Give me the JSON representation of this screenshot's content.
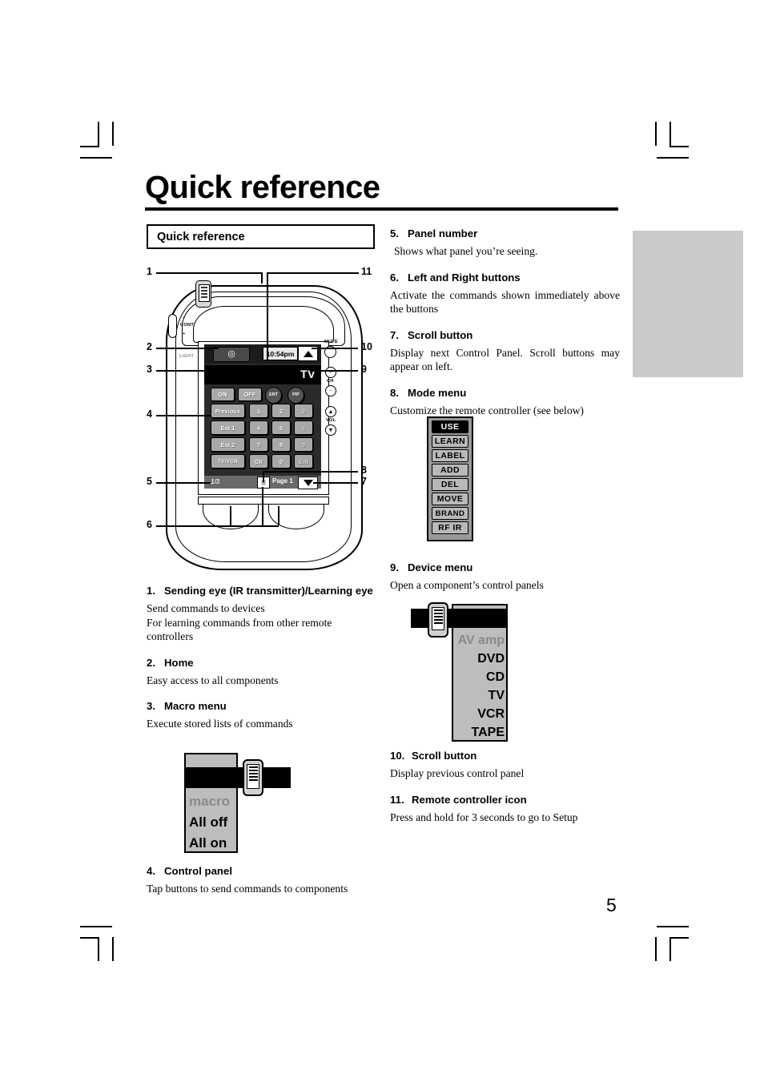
{
  "page": {
    "title": "Quick reference",
    "number": "5",
    "section_box_label": "Quick reference"
  },
  "items_left": [
    {
      "num": "1.",
      "title": "Sending eye (IR transmitter)/Learning eye",
      "body_line1": "Send commands to devices",
      "body_line2": "For learning commands from other remote controllers"
    },
    {
      "num": "2.",
      "title": "Home",
      "body_line1": "Easy access to all components"
    },
    {
      "num": "3.",
      "title": "Macro menu",
      "body_line1": "Execute stored lists of commands"
    },
    {
      "num": "4.",
      "title": "Control panel",
      "body_line1": "Tap buttons to send commands to components"
    }
  ],
  "items_right": [
    {
      "num": "5.",
      "title": "Panel number",
      "body_line1": "Shows what panel you’re seeing."
    },
    {
      "num": "6.",
      "title": "Left and Right buttons",
      "body_line1": "Activate the commands shown immediately above the buttons"
    },
    {
      "num": "7.",
      "title": "Scroll button",
      "body_line1": "Display next Control Panel. Scroll buttons may appear on left."
    },
    {
      "num": "8.",
      "title": "Mode menu",
      "body_line1": "Customize the remote controller (see below)"
    },
    {
      "num": "9.",
      "title": "Device menu",
      "body_line1": "Open a component’s control panels"
    },
    {
      "num": "10.",
      "title": "Scroll button",
      "body_line1": "Display previous control panel"
    },
    {
      "num": "11.",
      "title": "Remote controller icon",
      "body_line1": "Press and hold for 3 seconds to go to Setup"
    }
  ],
  "remote_figure": {
    "callouts": [
      "1",
      "2",
      "3",
      "4",
      "5",
      "6",
      "7",
      "8",
      "9",
      "10",
      "11"
    ],
    "lcd": {
      "time": "10:54pm",
      "device_label": "TV",
      "panel_number": "1/3",
      "page_label": "Page 1",
      "home_icon": "home-icon",
      "device_menu_icon": "device-menu-icon",
      "mode_menu_icon": "mode-menu-icon",
      "scroll_up_icon": "triangle-up-icon",
      "scroll_down_icon": "triangle-down-icon",
      "remote_controller_icon": "remote-controller-icon"
    },
    "control_panel_buttons": [
      "ON",
      "OFF",
      "ENT",
      "PIP",
      "Previous",
      "1",
      "2",
      "3",
      "Ext 1",
      "4",
      "5",
      "6",
      "Ext 2",
      "7",
      "8",
      "9",
      "TV/VCR",
      "Clr",
      "0",
      "Ent"
    ],
    "side_labels": {
      "contrast_minus": "–",
      "contrast": "CONT",
      "contrast_plus": "+",
      "light": "LIGHT",
      "mute": "MUTE",
      "channel": "CH",
      "volume": "VOL"
    }
  },
  "macro_menu": {
    "header": "macro",
    "rows": [
      "macro",
      "All off",
      "All on"
    ],
    "icon": "macro-menu-icon"
  },
  "mode_menu": {
    "keys": [
      "USE",
      "LEARN",
      "LABEL",
      "ADD",
      "DEL",
      "MOVE",
      "BRAND",
      "RF IR"
    ],
    "selected": "USE"
  },
  "device_menu": {
    "header": "AV amp",
    "rows": [
      "AV amp",
      "DVD",
      "CD",
      "TV",
      "VCR",
      "TAPE"
    ],
    "icon": "device-menu-icon"
  },
  "colors": {
    "side_tab": "#cacaca",
    "menu_panel": "#bdbdbd",
    "menu_header": "#000000",
    "greyed_row": "#8a8a8a"
  }
}
